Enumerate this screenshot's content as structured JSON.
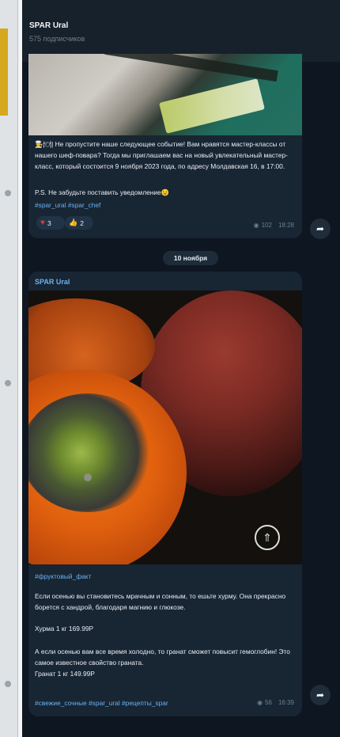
{
  "channel": {
    "title": "SPAR Ural",
    "subscribers": "575 подписчиков"
  },
  "post1": {
    "emojis": "👨‍🍳🍽",
    "text": "Не пропустите наше следующее событие! Вам нравятся мастер-классы от нашего шеф-повара? Тогда мы приглашаем вас на новый увлекательный мастер-класс, который состоится 9 ноября 2023 года, по адресу Молдавская 16, в 17:00.",
    "ps": "P.S. Не забудьте поставить уведомление😉",
    "hashtags": "#spar_ural #spar_chef",
    "reactions": [
      {
        "icon": "heart-icon",
        "count": "3"
      },
      {
        "icon": "thumbs-up-icon",
        "count": "2"
      }
    ],
    "views": "102",
    "time": "18:28"
  },
  "date_separator": "10 ноября",
  "post2": {
    "sender": "SPAR Ural",
    "hashtag_top": "#фруктовый_факт",
    "text1": "Если осенью вы становитесь мрачным и сонным, то ешьте хурму. Она прекрасно борется с хандрой, благодаря магнию и глюкозе.",
    "price1": "Хурма 1 кг 169.99Р",
    "text2": "А если осенью вам все время холодно, то гранат сможет повысит гемоглобин! Это самое известное свойство граната.",
    "price2": "Гранат 1 кг 149.99Р",
    "hashtags": "#свежие_сочные #spar_ural #рецепты_spar",
    "views": "56",
    "time": "16:39"
  },
  "icons": {
    "views": "eye-icon",
    "share": "share-arrow-icon",
    "logo": "spar-tree-logo"
  },
  "colors": {
    "bg": "#0e1621",
    "bubble": "#182533",
    "link": "#6ab2f2",
    "meta": "#6d7f8f",
    "heart": "#e0373b"
  }
}
